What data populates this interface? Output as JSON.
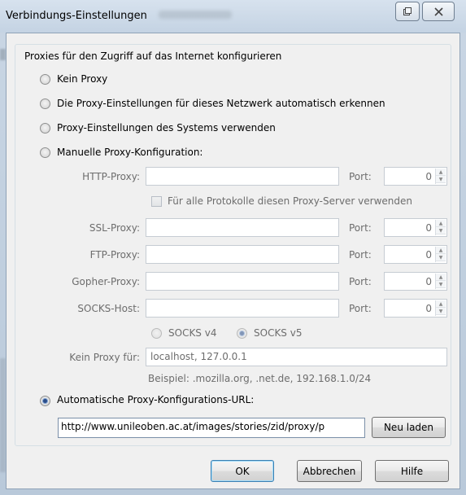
{
  "window": {
    "title": "Verbindungs-Einstellungen"
  },
  "group": {
    "legend": "Proxies für den Zugriff auf das Internet konfigurieren"
  },
  "radios": {
    "no_proxy": "Kein Proxy",
    "auto_detect": "Die Proxy-Einstellungen für dieses Netzwerk automatisch erkennen",
    "system": "Proxy-Einstellungen des Systems verwenden",
    "manual": "Manuelle Proxy-Konfiguration:",
    "pac": "Automatische Proxy-Konfigurations-URL:",
    "selected": "pac"
  },
  "manual": {
    "http_label": "HTTP-Proxy:",
    "ssl_label": "SSL-Proxy:",
    "ftp_label": "FTP-Proxy:",
    "gopher_label": "Gopher-Proxy:",
    "socks_label": "SOCKS-Host:",
    "port_label": "Port:",
    "port_value": "0",
    "share_all": "Für alle Protokolle diesen Proxy-Server verwenden",
    "socks_v4": "SOCKS v4",
    "socks_v5": "SOCKS v5",
    "no_proxy_for_label": "Kein Proxy für:",
    "no_proxy_for_value": "localhost, 127.0.0.1",
    "example": "Beispiel: .mozilla.org, .net.de, 192.168.1.0/24"
  },
  "pac": {
    "url_value": "http://www.unileoben.ac.at/images/stories/zid/proxy/p",
    "reload_button": "Neu laden"
  },
  "footer": {
    "ok": "OK",
    "cancel": "Abbrechen",
    "help": "Hilfe"
  }
}
